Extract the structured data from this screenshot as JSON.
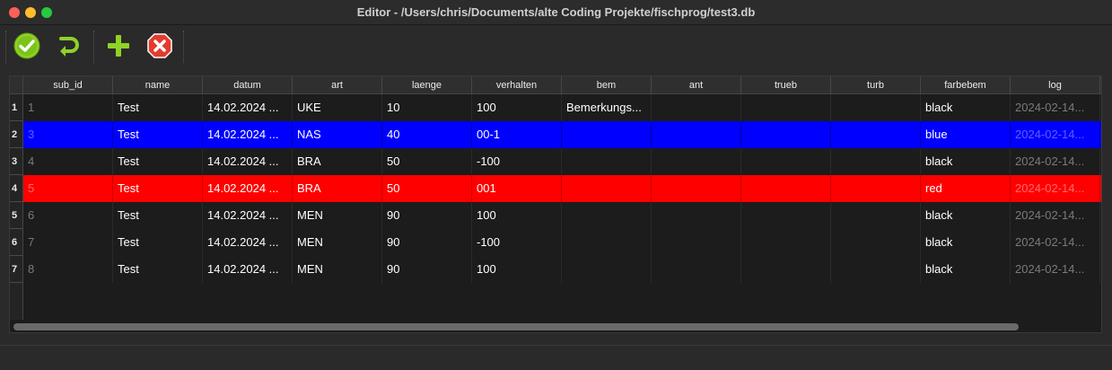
{
  "window": {
    "title": "Editor - /Users/chris/Documents/alte Coding Projekte/fischprog/test3.db"
  },
  "toolbar": {
    "buttons": [
      {
        "icon": "checkmark-icon",
        "color": "#7cc31a"
      },
      {
        "icon": "undo-icon",
        "color": "#7cc31a"
      },
      {
        "icon": "plus-icon",
        "color": "#7cc31a"
      },
      {
        "icon": "delete-icon",
        "color": "#e33b2e"
      }
    ]
  },
  "table": {
    "columns": [
      "sub_id",
      "name",
      "datum",
      "art",
      "laenge",
      "verhalten",
      "bem",
      "ant",
      "trueb",
      "turb",
      "farbebem",
      "log"
    ],
    "row_numbers": [
      "1",
      "2",
      "3",
      "4",
      "5",
      "6",
      "7"
    ],
    "rows": [
      [
        "1",
        "Test",
        "14.02.2024 ...",
        "UKE",
        "10",
        "100",
        "Bemerkungs...",
        "",
        "",
        "",
        "black",
        "2024-02-14..."
      ],
      [
        "3",
        "Test",
        "14.02.2024 ...",
        "NAS",
        "40",
        "00-1",
        "",
        "",
        "",
        "",
        "blue",
        "2024-02-14..."
      ],
      [
        "4",
        "Test",
        "14.02.2024 ...",
        "BRA",
        "50",
        "-100",
        "",
        "",
        "",
        "",
        "black",
        "2024-02-14..."
      ],
      [
        "5",
        "Test",
        "14.02.2024 ...",
        "BRA",
        "50",
        "001",
        "",
        "",
        "",
        "",
        "red",
        "2024-02-14..."
      ],
      [
        "6",
        "Test",
        "14.02.2024 ...",
        "MEN",
        "90",
        "100",
        "",
        "",
        "",
        "",
        "black",
        "2024-02-14..."
      ],
      [
        "7",
        "Test",
        "14.02.2024 ...",
        "MEN",
        "90",
        "-100",
        "",
        "",
        "",
        "",
        "black",
        "2024-02-14..."
      ],
      [
        "8",
        "Test",
        "14.02.2024 ...",
        "MEN",
        "90",
        "100",
        "",
        "",
        "",
        "",
        "black",
        "2024-02-14..."
      ]
    ],
    "row_colors": [
      "",
      "#0000ff",
      "",
      "#ff0000",
      "",
      "",
      ""
    ]
  }
}
